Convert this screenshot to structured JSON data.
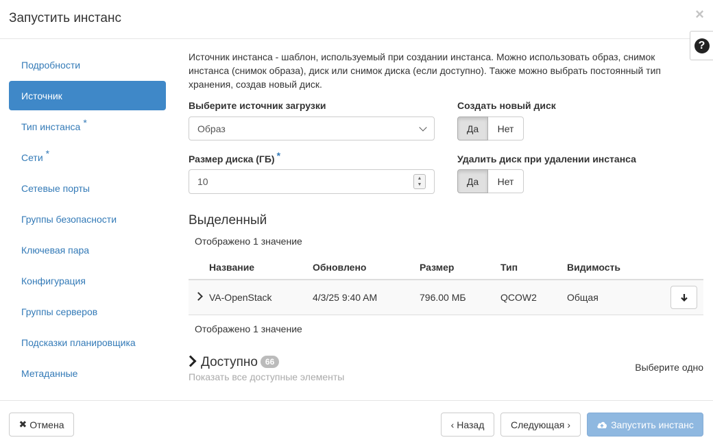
{
  "header": {
    "title": "Запустить инстанс",
    "close_icon": "×",
    "help_icon": "?"
  },
  "sidebar": {
    "items": [
      {
        "label": "Подробности",
        "required": false,
        "active": false
      },
      {
        "label": "Источник",
        "required": false,
        "active": true
      },
      {
        "label": "Тип инстанса",
        "required": true,
        "active": false
      },
      {
        "label": "Сети",
        "required": true,
        "active": false
      },
      {
        "label": "Сетевые порты",
        "required": false,
        "active": false
      },
      {
        "label": "Группы безопасности",
        "required": false,
        "active": false
      },
      {
        "label": "Ключевая пара",
        "required": false,
        "active": false
      },
      {
        "label": "Конфигурация",
        "required": false,
        "active": false
      },
      {
        "label": "Группы серверов",
        "required": false,
        "active": false
      },
      {
        "label": "Подсказки планировщика",
        "required": false,
        "active": false
      },
      {
        "label": "Метаданные",
        "required": false,
        "active": false
      }
    ]
  },
  "main": {
    "intro": "Источник инстанса - шаблон, используемый при создании инстанса. Можно использовать образ, снимок инстанса (снимок образа), диск или снимок диска (если доступно). Также можно выбрать постоянный тип хранения, создав новый диск.",
    "boot_source": {
      "label": "Выберите источник загрузки",
      "value": "Образ"
    },
    "create_volume": {
      "label": "Создать новый диск",
      "yes": "Да",
      "no": "Нет",
      "selected": "yes"
    },
    "volume_size": {
      "label": "Размер диска (ГБ)",
      "required_mark": "*",
      "value": "10"
    },
    "delete_volume": {
      "label": "Удалить диск при удалении инстанса",
      "yes": "Да",
      "no": "Нет",
      "selected": "yes"
    },
    "allocated": {
      "title": "Выделенный",
      "count_top": "Отображено 1 значение",
      "count_bottom": "Отображено 1 значение",
      "columns": [
        "Название",
        "Обновлено",
        "Размер",
        "Тип",
        "Видимость"
      ],
      "rows": [
        {
          "name": "VA-OpenStack",
          "updated": "4/3/25 9:40 AM",
          "size": "796.00 МБ",
          "type": "QCOW2",
          "visibility": "Общая"
        }
      ]
    },
    "available": {
      "title": "Доступно",
      "count": "66",
      "subtitle": "Показать все доступные элементы",
      "select_one": "Выберите одно"
    }
  },
  "footer": {
    "cancel": "Отмена",
    "back": "Назад",
    "next": "Следующая",
    "launch": "Запустить инстанс"
  }
}
